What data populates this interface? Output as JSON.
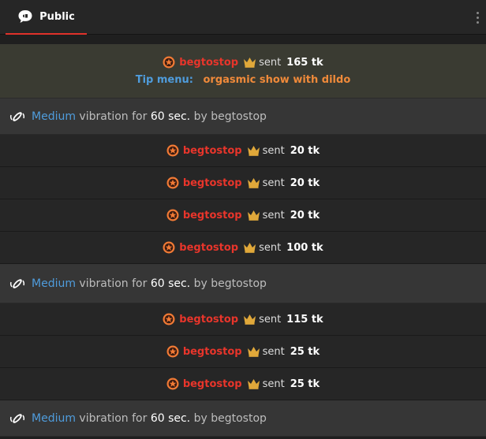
{
  "header": {
    "tab_label": "Public"
  },
  "tip_menu_message": {
    "username": "begtostop",
    "sent_label": "sent",
    "amount": "165 tk",
    "tip_menu_label": "Tip menu:",
    "tip_menu_item": "orgasmic show with dildo"
  },
  "vibration": {
    "level": "Medium",
    "text_mid": " vibration for ",
    "duration": "60 sec.",
    "by_label": " by ",
    "username": "begtostop"
  },
  "feed": [
    {
      "type": "vib"
    },
    {
      "type": "tip",
      "username": "begtostop",
      "sent_label": "sent",
      "amount": "20 tk"
    },
    {
      "type": "tip",
      "username": "begtostop",
      "sent_label": "sent",
      "amount": "20 tk"
    },
    {
      "type": "tip",
      "username": "begtostop",
      "sent_label": "sent",
      "amount": "20 tk"
    },
    {
      "type": "tip",
      "username": "begtostop",
      "sent_label": "sent",
      "amount": "100 tk"
    },
    {
      "type": "vib"
    },
    {
      "type": "tip",
      "username": "begtostop",
      "sent_label": "sent",
      "amount": "115 tk"
    },
    {
      "type": "tip",
      "username": "begtostop",
      "sent_label": "sent",
      "amount": "25 tk"
    },
    {
      "type": "tip",
      "username": "begtostop",
      "sent_label": "sent",
      "amount": "25 tk"
    },
    {
      "type": "vib"
    }
  ],
  "colors": {
    "username": "#e8352b",
    "accent_tab": "#e0312a",
    "tip_label": "#4f9cdc",
    "tip_item": "#f08a3a",
    "crown": "#e0a83a",
    "badge": "#f07a35"
  }
}
